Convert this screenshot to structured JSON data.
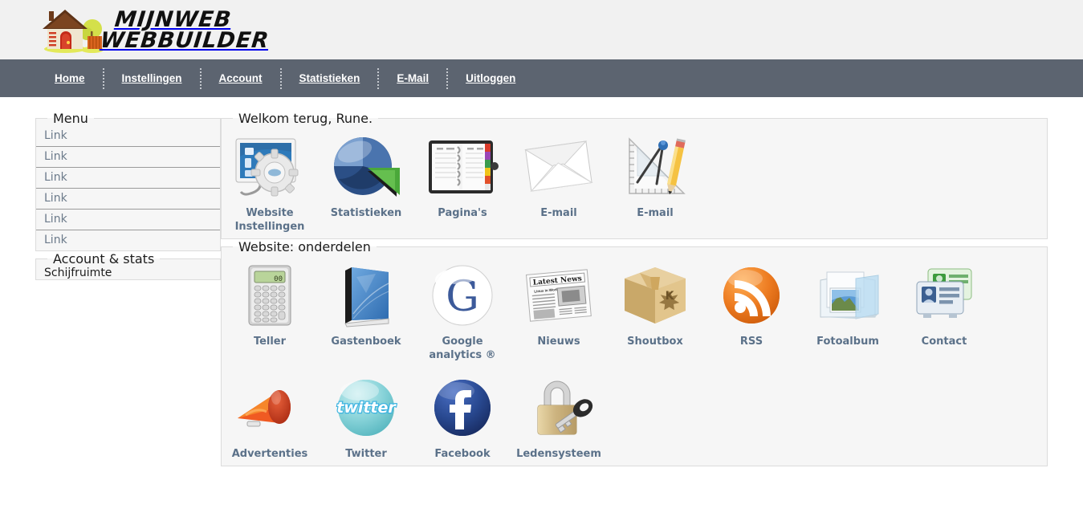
{
  "brand": {
    "line1": "MIJNWEB",
    "line2": "WEBBUILDER",
    "house_icon": "house-logo-icon"
  },
  "nav": {
    "items": [
      {
        "label": "Home"
      },
      {
        "label": "Instellingen"
      },
      {
        "label": "Account"
      },
      {
        "label": "Statistieken"
      },
      {
        "label": "E-Mail"
      },
      {
        "label": "Uitloggen"
      }
    ]
  },
  "sidebar": {
    "menu": {
      "legend": "Menu",
      "links": [
        {
          "label": "Link"
        },
        {
          "label": "Link"
        },
        {
          "label": "Link"
        },
        {
          "label": "Link"
        },
        {
          "label": "Link"
        },
        {
          "label": "Link"
        }
      ]
    },
    "stats": {
      "legend": "Account & stats",
      "items": [
        {
          "label": "Schijfruimte"
        }
      ]
    }
  },
  "welcome": {
    "legend": "Welkom terug, Rune.",
    "tiles": [
      {
        "label": "Website Instellingen",
        "icon": "monitor-gear-icon"
      },
      {
        "label": "Statistieken",
        "icon": "pie-chart-icon"
      },
      {
        "label": "Pagina's",
        "icon": "ring-binder-icon"
      },
      {
        "label": "E-mail",
        "icon": "envelope-icon"
      },
      {
        "label": "E-mail",
        "icon": "ruler-compass-pencil-icon"
      }
    ]
  },
  "onderdelen": {
    "legend": "Website: onderdelen",
    "tiles": [
      {
        "label": "Teller",
        "icon": "calculator-icon"
      },
      {
        "label": "Gastenboek",
        "icon": "blue-book-icon"
      },
      {
        "label": "Google analytics ®",
        "icon": "google-g-icon"
      },
      {
        "label": "Nieuws",
        "icon": "newspaper-icon"
      },
      {
        "label": "Shoutbox",
        "icon": "cardboard-box-icon"
      },
      {
        "label": "RSS",
        "icon": "rss-feed-icon"
      },
      {
        "label": "Fotoalbum",
        "icon": "photo-folder-icon"
      },
      {
        "label": "Contact",
        "icon": "contact-card-icon"
      },
      {
        "label": "Advertenties",
        "icon": "megaphone-icon"
      },
      {
        "label": "Twitter",
        "icon": "twitter-icon"
      },
      {
        "label": "Facebook",
        "icon": "facebook-icon"
      },
      {
        "label": "Ledensysteem",
        "icon": "padlock-key-icon"
      }
    ]
  },
  "colors": {
    "navbar": "#5c6470",
    "header_bg": "#f1f1f1",
    "fieldset_bg": "#f6f6f6",
    "fieldset_border": "#dcdcdc",
    "tile_label": "#5b7189",
    "menu_link": "#6b7a8a"
  }
}
